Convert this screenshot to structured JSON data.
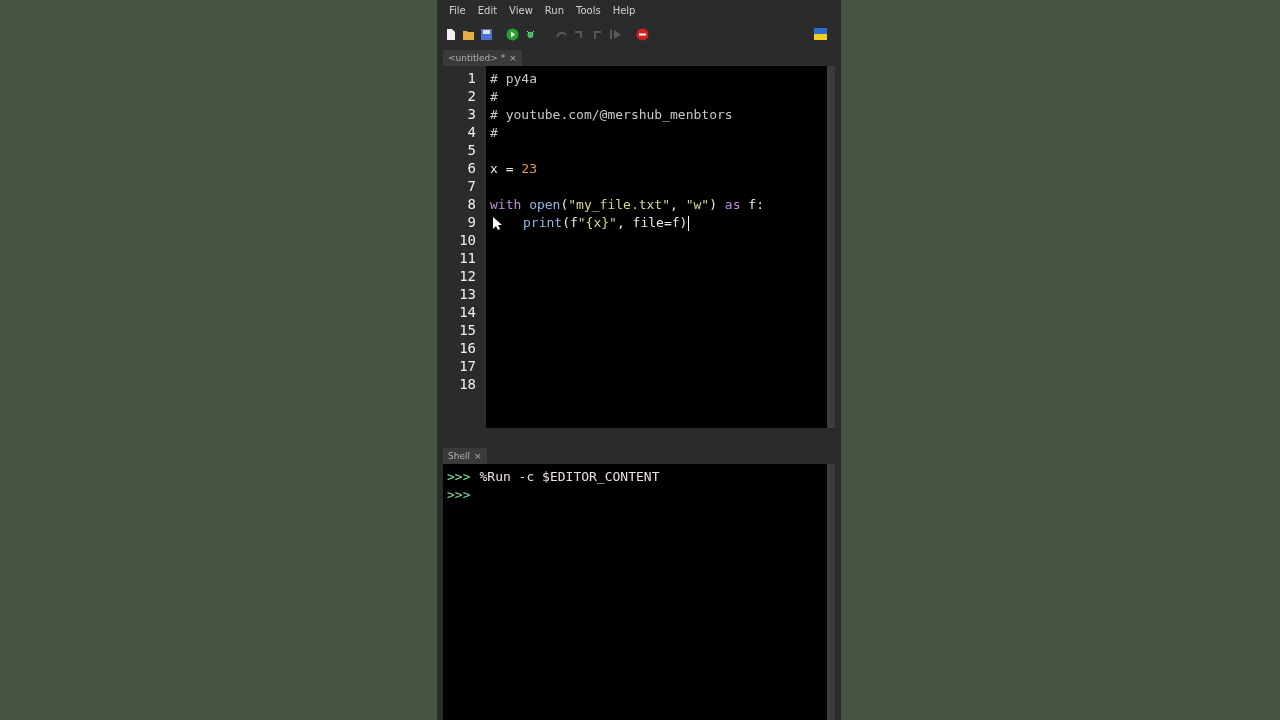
{
  "menu": [
    "File",
    "Edit",
    "View",
    "Run",
    "Tools",
    "Help"
  ],
  "toolbar": [
    {
      "kind": "new",
      "disabled": false
    },
    {
      "kind": "open",
      "disabled": false
    },
    {
      "kind": "save",
      "disabled": false
    },
    {
      "kind": "run",
      "disabled": false
    },
    {
      "kind": "debug",
      "disabled": false
    },
    {
      "kind": "step-over",
      "disabled": true
    },
    {
      "kind": "step-into",
      "disabled": true
    },
    {
      "kind": "step-out",
      "disabled": true
    },
    {
      "kind": "resume",
      "disabled": true
    },
    {
      "kind": "stop",
      "disabled": false
    }
  ],
  "editor_tab": {
    "label": "<untitled> *",
    "close": "×"
  },
  "code_lines": [
    {
      "number": "1",
      "caret": false,
      "indented": false,
      "tokens": [
        {
          "kind": "comment",
          "text": "# py4a"
        }
      ]
    },
    {
      "number": "2",
      "caret": false,
      "indented": false,
      "tokens": [
        {
          "kind": "comment",
          "text": "#"
        }
      ]
    },
    {
      "number": "3",
      "caret": false,
      "indented": false,
      "tokens": [
        {
          "kind": "comment",
          "text": "# youtube.com/@mershub_menbtors"
        }
      ]
    },
    {
      "number": "4",
      "caret": false,
      "indented": false,
      "tokens": [
        {
          "kind": "comment",
          "text": "#"
        }
      ]
    },
    {
      "number": "5",
      "caret": false
    },
    {
      "number": "6",
      "caret": false,
      "indented": false,
      "tokens": [
        {
          "kind": "plain",
          "text": "x = "
        },
        {
          "kind": "number",
          "text": "23"
        }
      ]
    },
    {
      "number": "7",
      "caret": false
    },
    {
      "number": "8",
      "caret": false,
      "indented": false,
      "tokens": [
        {
          "kind": "keyword",
          "text": "with "
        },
        {
          "kind": "builtin",
          "text": "open"
        },
        {
          "kind": "plain",
          "text": "("
        },
        {
          "kind": "string",
          "text": "\"my_file.txt\""
        },
        {
          "kind": "plain",
          "text": ", "
        },
        {
          "kind": "string",
          "text": "\"w\""
        },
        {
          "kind": "plain",
          "text": ") "
        },
        {
          "kind": "keyword",
          "text": "as"
        },
        {
          "kind": "plain",
          "text": " f:"
        }
      ]
    },
    {
      "number": "9",
      "caret": true,
      "indented": true,
      "tokens": [
        {
          "kind": "builtin",
          "text": "print"
        },
        {
          "kind": "plain",
          "text": "(f"
        },
        {
          "kind": "string",
          "text": "\"{x}\""
        },
        {
          "kind": "plain",
          "text": ", file=f)"
        }
      ]
    },
    {
      "number": "10",
      "caret": false
    },
    {
      "number": "11",
      "caret": false
    },
    {
      "number": "12",
      "caret": false
    },
    {
      "number": "13",
      "caret": false
    },
    {
      "number": "14",
      "caret": false
    },
    {
      "number": "15",
      "caret": false
    },
    {
      "number": "16",
      "caret": false
    },
    {
      "number": "17",
      "caret": false
    },
    {
      "number": "18",
      "caret": false
    }
  ],
  "shell_tab": {
    "label": "Shell",
    "close": "×"
  },
  "shell_lines": [
    {
      "prompt": ">>>",
      "command": "%Run -c $EDITOR_CONTENT"
    },
    {
      "prompt": ">>>"
    }
  ]
}
